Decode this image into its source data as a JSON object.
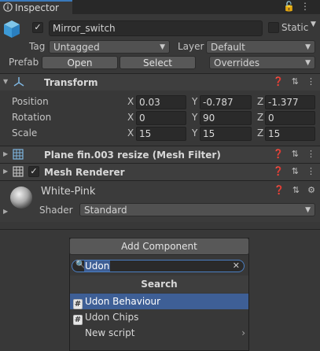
{
  "window": {
    "tab_label": "Inspector"
  },
  "object": {
    "name": "Mirror_switch",
    "static_label": "Static",
    "tag_label": "Tag",
    "tag_value": "Untagged",
    "layer_label": "Layer",
    "layer_value": "Default",
    "prefab_label": "Prefab",
    "prefab_open": "Open",
    "prefab_select": "Select",
    "prefab_overrides": "Overrides"
  },
  "transform": {
    "title": "Transform",
    "rows": [
      {
        "label": "Position",
        "x": "0.03",
        "y": "-0.787",
        "z": "-1.377"
      },
      {
        "label": "Rotation",
        "x": "0",
        "y": "90",
        "z": "0"
      },
      {
        "label": "Scale",
        "x": "15",
        "y": "15",
        "z": "15"
      }
    ],
    "axis": {
      "x": "X",
      "y": "Y",
      "z": "Z"
    }
  },
  "mesh_filter": {
    "title": "Plane fin.003 resize (Mesh Filter)"
  },
  "mesh_renderer": {
    "title": "Mesh Renderer"
  },
  "material": {
    "name": "White-Pink",
    "shader_label": "Shader",
    "shader_value": "Standard"
  },
  "add_component": {
    "button_label": "Add Component",
    "search_value": "Udon",
    "header": "Search",
    "items": [
      {
        "label": "Udon Behaviour",
        "icon": "script-icon"
      },
      {
        "label": "Udon Chips",
        "icon": "script-icon"
      },
      {
        "label": "New script",
        "icon": ""
      }
    ]
  },
  "colors": {
    "background": "#383838",
    "accent": "#3a79bb",
    "selection": "#3e5f96"
  }
}
